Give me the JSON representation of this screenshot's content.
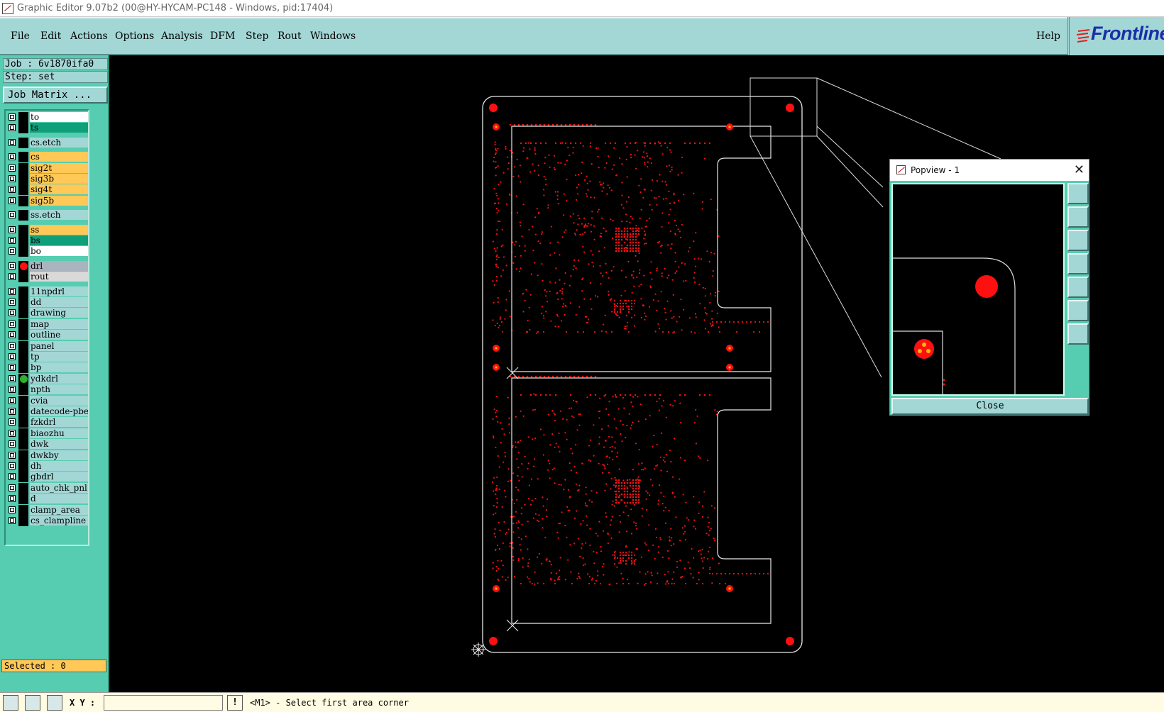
{
  "window": {
    "title": "Graphic Editor 9.07b2 (00@HY-HYCAM-PC148 - Windows, pid:17404)"
  },
  "menu": {
    "items": [
      "File",
      "Edit",
      "Actions",
      "Options",
      "Analysis",
      "DFM",
      "Step",
      "Rout",
      "Windows"
    ],
    "help": "Help"
  },
  "logo": {
    "text": "Frontline"
  },
  "job": {
    "job_label": "Job : 6v1870ifa0",
    "step_label": "Step: set",
    "matrix_button": "Job Matrix ..."
  },
  "layers": [
    {
      "name": "to",
      "color": "#ffffff",
      "dot": ""
    },
    {
      "name": "ts",
      "color": "#0fa07a",
      "dot": ""
    },
    {
      "name": "cs.etch",
      "color": "#a2d7d6",
      "dot": ""
    },
    {
      "name": "cs",
      "color": "#ffc857",
      "dot": ""
    },
    {
      "name": "sig2t",
      "color": "#ffc857",
      "dot": ""
    },
    {
      "name": "sig3b",
      "color": "#ffc857",
      "dot": ""
    },
    {
      "name": "sig4t",
      "color": "#ffc857",
      "dot": ""
    },
    {
      "name": "sig5b",
      "color": "#ffc857",
      "dot": ""
    },
    {
      "name": "ss.etch",
      "color": "#a2d7d6",
      "dot": ""
    },
    {
      "name": "ss",
      "color": "#ffc857",
      "dot": ""
    },
    {
      "name": "bs",
      "color": "#0fa07a",
      "dot": ""
    },
    {
      "name": "bo",
      "color": "#ffffff",
      "dot": ""
    },
    {
      "name": "drl",
      "color": "#a9b4bf",
      "dot": "#ff1010"
    },
    {
      "name": "rout",
      "color": "#d9d9d9",
      "dot": ""
    },
    {
      "name": "11npdrl",
      "color": "#a2d7d6",
      "dot": ""
    },
    {
      "name": "dd",
      "color": "#a2d7d6",
      "dot": ""
    },
    {
      "name": "drawing",
      "color": "#a2d7d6",
      "dot": ""
    },
    {
      "name": "map",
      "color": "#a2d7d6",
      "dot": ""
    },
    {
      "name": "outline",
      "color": "#a2d7d6",
      "dot": ""
    },
    {
      "name": "panel",
      "color": "#a2d7d6",
      "dot": ""
    },
    {
      "name": "tp",
      "color": "#a2d7d6",
      "dot": ""
    },
    {
      "name": "bp",
      "color": "#a2d7d6",
      "dot": ""
    },
    {
      "name": "ydkdrl",
      "color": "#a2d7d6",
      "dot": "#2fb02f"
    },
    {
      "name": "npth",
      "color": "#a2d7d6",
      "dot": ""
    },
    {
      "name": "cvia",
      "color": "#a2d7d6",
      "dot": ""
    },
    {
      "name": "datecode-pbe",
      "color": "#a2d7d6",
      "dot": ""
    },
    {
      "name": "fzkdrl",
      "color": "#a2d7d6",
      "dot": ""
    },
    {
      "name": "biaozhu",
      "color": "#a2d7d6",
      "dot": ""
    },
    {
      "name": "dwk",
      "color": "#a2d7d6",
      "dot": ""
    },
    {
      "name": "dwkby",
      "color": "#a2d7d6",
      "dot": ""
    },
    {
      "name": "dh",
      "color": "#a2d7d6",
      "dot": ""
    },
    {
      "name": "gbdrl",
      "color": "#a2d7d6",
      "dot": ""
    },
    {
      "name": "auto_chk_pnl",
      "color": "#a2d7d6",
      "dot": ""
    },
    {
      "name": "d",
      "color": "#a2d7d6",
      "dot": ""
    },
    {
      "name": "clamp_area",
      "color": "#a2d7d6",
      "dot": ""
    },
    {
      "name": "cs_clampline",
      "color": "#a2d7d6",
      "dot": ""
    }
  ],
  "selected": {
    "label": "Selected : 0"
  },
  "status": {
    "xy_label": "X Y :",
    "xy_value": "",
    "message": "<M1> - Select first area corner"
  },
  "popview": {
    "title": "Popview - 1",
    "close_label": "Close"
  },
  "colors": {
    "panel": "#56cdb0",
    "menubar": "#a2d7d6",
    "feature": "#ff1010",
    "outline": "#ffffff"
  }
}
